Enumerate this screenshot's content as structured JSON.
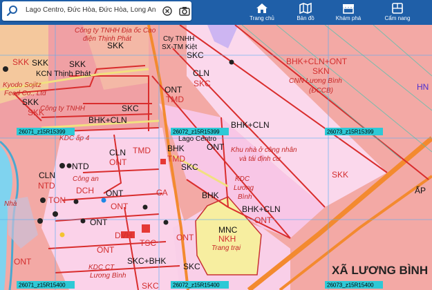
{
  "search": {
    "value": "Lago Centro, Đức Hòa, Đức Hòa, Long An"
  },
  "nav": [
    {
      "label": "Trang chủ",
      "icon": "home-icon"
    },
    {
      "label": "Bản đồ",
      "icon": "map-icon"
    },
    {
      "label": "Khám phá",
      "icon": "store-icon"
    },
    {
      "label": "Cẩm nang",
      "icon": "book-icon"
    }
  ],
  "sheets": {
    "s1": "26071_z15R15399",
    "s2": "26072_z15R15399",
    "s3": "26073_z15R15399",
    "s4": "26071_z15R15400",
    "s5": "26072_z15R15400",
    "s6": "26073_z15R15400"
  },
  "labels": {
    "company_dia_cao": "Công ty TNHH Địa ốc Cao",
    "company_dien_thinh_phat": "điện Thịnh Phát",
    "cty_tnhh": "Cty TNHH",
    "sx_tm_kiet": "SX-TM Kiệt",
    "kcn_thinh_phat": "KCN Thịnh Phát",
    "kyodo_sojitz": "Kyodo Sojitz",
    "feed_co": "Feed Co., Ltd",
    "cong_ty_tnhh": "Công ty TNHH",
    "kdc_ap4": "KDC ấp 4",
    "lago_centro": "Lago Centro",
    "khu_nha_o": "Khu nhà ở công nhân",
    "va_tai_dinh_cu": "và tái định cư",
    "cnn_luong_binh": "CNN Lương Bình",
    "dccb": "(ĐCCB)",
    "kdc": "KDC",
    "luong_binh": "Lương",
    "binh": "Bình",
    "trang_trai": "Trang trại",
    "kdc_ct": "KDC CT",
    "luong_binh2": "Lương Bình",
    "nha": "Nhà",
    "cong_an": "Công an",
    "xa_luong_binh": "XÃ LƯƠNG BÌNH"
  },
  "codes": {
    "skk1": "SKK",
    "skk2": "SKK",
    "skk3": "SKK",
    "skk4": "SKK",
    "skk5": "SKK",
    "skk6": "SKK",
    "skk7": "SKK",
    "skc1": "SKC",
    "skc2": "SKC",
    "skc3": "SKC",
    "skc4": "SKC",
    "skc5": "SKC",
    "skc6": "SKC",
    "ont1": "ONT",
    "ont2": "ONT",
    "ont3": "ONT",
    "ont4": "ONT",
    "ont5": "ONT",
    "ont6": "ONT",
    "ont7": "ONT",
    "ont8": "ONT",
    "ont9": "ONT",
    "ont10": "ONT",
    "ont11": "ONT",
    "bhk_cln_ont": "BHK+CLN+ONT",
    "skn": "SKN",
    "cln1": "CLN",
    "cln2": "CLN",
    "cln3": "CLN",
    "tmd1": "TMD",
    "tmd2": "TMD",
    "tmd3": "TMD",
    "bhk_cln1": "BHK+CLN",
    "bhk_cln2": "BHK+CLN",
    "bhk_cln3": "BHK+CLN",
    "bhk1": "BHK",
    "bhk2": "BHK",
    "ntd1": "NTD",
    "ntd2": "NTD",
    "dch": "DCH",
    "ca": "CA",
    "ton": "TON",
    "dvh": "DVH",
    "tsc": "TSC",
    "mnc": "MNC",
    "nkh": "NKH",
    "skc_bhk": "SKC+BHK",
    "ap": "ẤP",
    "hn": "HN"
  }
}
